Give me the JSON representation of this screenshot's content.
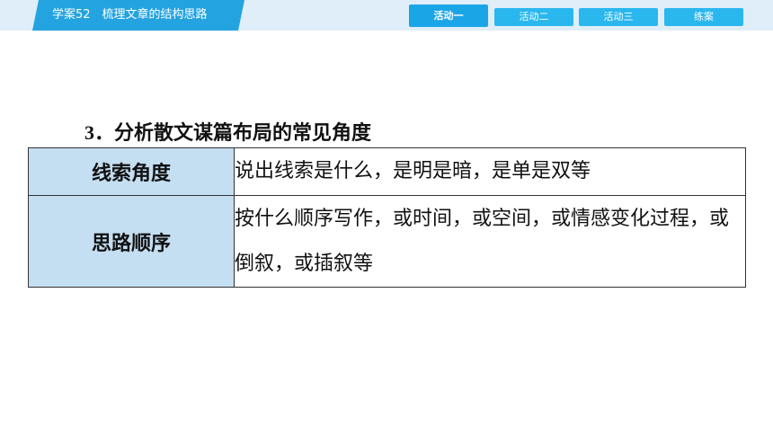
{
  "header": {
    "title": "学案52　梳理文章的结构思路",
    "nav": [
      {
        "label": "活动一",
        "active": true
      },
      {
        "label": "活动二",
        "active": false
      },
      {
        "label": "活动三",
        "active": false
      },
      {
        "label": "练案",
        "active": false
      }
    ]
  },
  "section": {
    "number": "3．",
    "title": "分析散文谋篇布局的常见角度"
  },
  "table": {
    "rows": [
      {
        "category": "线索角度",
        "description": "说出线索是什么，是明是暗，是单是双等"
      },
      {
        "category": "思路顺序",
        "description": "按什么顺序写作，或时间，或空间，或情感变化过程，或倒叙，或插叙等"
      }
    ]
  },
  "colors": {
    "title_tab": "#23a3e0",
    "nav_button": "#29b7ee",
    "header_bg": "#dfeef8",
    "category_cell": "#c4def2"
  }
}
